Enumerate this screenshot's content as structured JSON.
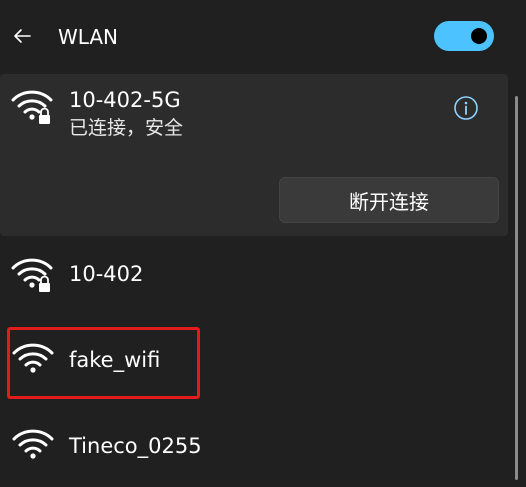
{
  "header": {
    "back_icon": "arrow-left-icon",
    "title": "WLAN",
    "toggle_state": "on",
    "toggle_color": "#4cc2ff"
  },
  "connected_network": {
    "name": "10-402-5G",
    "status": "已连接，安全",
    "icon": "wifi-secured-icon",
    "info_icon": "info-icon",
    "disconnect_label": "断开连接"
  },
  "networks": [
    {
      "name": "10-402",
      "icon": "wifi-secured-icon",
      "secured": true
    },
    {
      "name": "fake_wifi",
      "icon": "wifi-icon",
      "secured": false
    },
    {
      "name": "Tineco_0255",
      "icon": "wifi-icon",
      "secured": false
    }
  ],
  "annotation": {
    "color": "#e21c1c",
    "target": "fake_wifi"
  }
}
